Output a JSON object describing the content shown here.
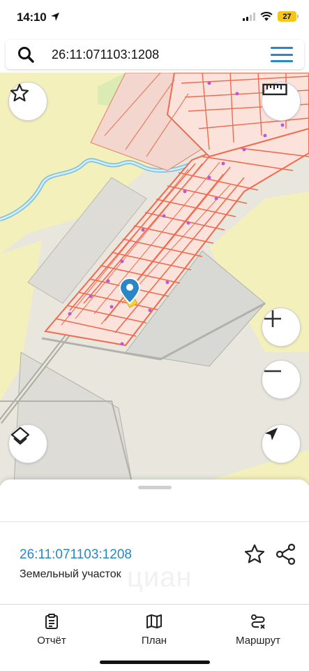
{
  "status_bar": {
    "time": "14:10",
    "battery": "27",
    "icons": [
      "location-arrow-icon",
      "cellular-signal-icon",
      "wifi-icon",
      "battery-icon"
    ]
  },
  "search": {
    "query": "26:11:071103:1208",
    "icons": [
      "search-icon",
      "menu-icon"
    ]
  },
  "map": {
    "controls": [
      "favorite-star-icon",
      "ruler-icon",
      "zoom-in-icon",
      "zoom-out-icon",
      "layers-icon",
      "navigate-arrow-icon"
    ],
    "marker": "map-pin-icon",
    "colors": {
      "parcel_outline": "#f26a4b",
      "parcel_dot": "#b85bd6",
      "land_yellow": "#f3efb8",
      "river": "#a8d8ec",
      "road": "#b0b4aa",
      "marker": "#2b86c5",
      "selected_parcel": "#f2d33a"
    }
  },
  "sheet": {
    "parcel_id": "26:11:071103:1208",
    "parcel_type": "Земельный участок",
    "watermark": "циан",
    "actions": [
      "favorite-icon",
      "share-icon"
    ]
  },
  "tabs": [
    {
      "label": "Отчёт",
      "icon": "report-icon"
    },
    {
      "label": "План",
      "icon": "map-plan-icon"
    },
    {
      "label": "Маршрут",
      "icon": "route-icon"
    }
  ],
  "accent_color": "#2b86c5"
}
